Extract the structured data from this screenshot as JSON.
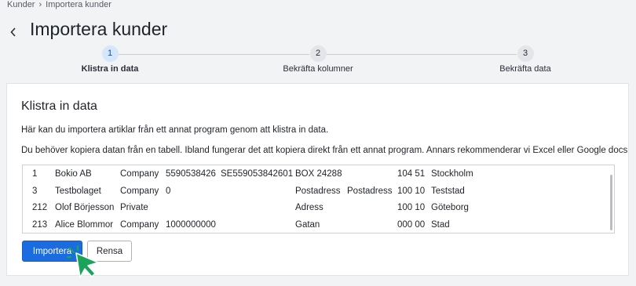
{
  "breadcrumb": {
    "items": [
      "Kunder",
      "Importera kunder"
    ],
    "separator": "›"
  },
  "header": {
    "title": "Importera kunder"
  },
  "stepper": {
    "steps": [
      {
        "number": "1",
        "label": "Klistra in data",
        "active": true
      },
      {
        "number": "2",
        "label": "Bekräfta kolumner",
        "active": false
      },
      {
        "number": "3",
        "label": "Bekräfta data",
        "active": false
      }
    ]
  },
  "card": {
    "title": "Klistra in data",
    "description_1": "Här kan du importera artiklar från ett annat program genom att klistra in data.",
    "description_2": "Du behöver kopiera datan från en tabell. Ibland fungerar det att kopiera direkt från ett annat program. Annars rekommenderar vi Excel eller Google docs",
    "paste_rows": [
      [
        "1",
        "Bokio AB",
        "Company",
        "5590538426",
        "SE559053842601",
        "BOX 24288",
        "",
        "104 51",
        "Stockholm"
      ],
      [
        "3",
        "Testbolaget",
        "Company",
        "0",
        "",
        "Postadress",
        "Postadress",
        "100 10",
        "Teststad"
      ],
      [
        "212",
        "Olof Börjesson",
        "Private",
        "",
        "",
        "Adress",
        "",
        "100 10",
        "Göteborg"
      ],
      [
        "213",
        "Alice Blommor",
        "Company",
        "1000000000",
        "",
        "Gatan",
        "",
        "000 00",
        "Stad"
      ]
    ],
    "import_button": "Importera",
    "clear_button": "Rensa"
  },
  "colors": {
    "primary": "#1a6ce0",
    "active_step": "#d6e6fb",
    "cursor": "#1aa35a"
  },
  "icons": {
    "back": "chevron-left-icon",
    "cursor": "pointer-cursor-icon"
  }
}
